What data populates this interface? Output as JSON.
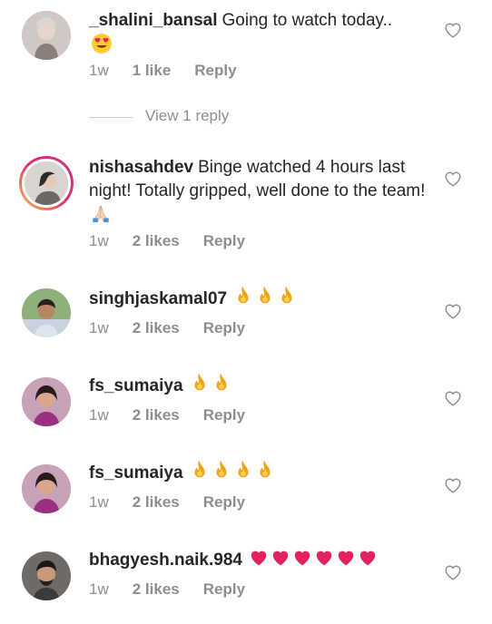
{
  "comments": [
    {
      "username": "_shalini_bansal",
      "text": "Going to watch today..",
      "emoji": "heart-eyes-emoji",
      "time": "1w",
      "likes": "1 like",
      "reply_label": "Reply",
      "view_replies": "View 1 reply"
    },
    {
      "username": "nishasahdev",
      "text": "Binge watched 4 hours last night! Totally gripped, well done to the team!",
      "emoji": "folded-hands-emoji",
      "time": "1w",
      "likes": "2 likes",
      "reply_label": "Reply",
      "has_story_ring": true
    },
    {
      "username": "singhjaskamal07",
      "text": "",
      "emoji": "fire-emoji x3",
      "time": "1w",
      "likes": "2 likes",
      "reply_label": "Reply"
    },
    {
      "username": "fs_sumaiya",
      "text": "",
      "emoji": "fire-emoji x2",
      "time": "1w",
      "likes": "2 likes",
      "reply_label": "Reply"
    },
    {
      "username": "fs_sumaiya",
      "text": "",
      "emoji": "fire-emoji x4",
      "time": "1w",
      "likes": "2 likes",
      "reply_label": "Reply"
    },
    {
      "username": "bhagyesh.naik.984",
      "text": "",
      "emoji": "red-heart-emoji x6",
      "time": "1w",
      "likes": "2 likes",
      "reply_label": "Reply"
    }
  ],
  "colors": {
    "text": "#262626",
    "muted": "#8e8e8e",
    "fire": "#f7a21b",
    "heart": "#e0245e",
    "story_ring": "#e1306c"
  }
}
